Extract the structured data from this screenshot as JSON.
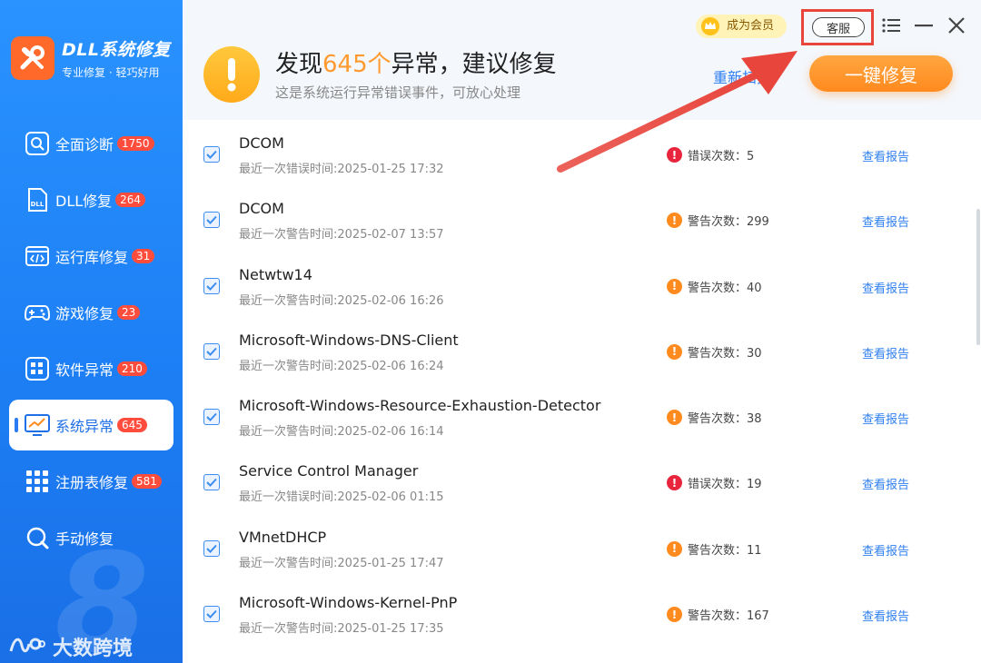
{
  "brand": {
    "title": "DLL系统修复",
    "subtitle": "专业修复 · 轻巧好用"
  },
  "nav": [
    {
      "label": "全面诊断",
      "badge": "1750",
      "icon": "diagnosis-icon",
      "active": false
    },
    {
      "label": "DLL修复",
      "badge": "264",
      "icon": "dll-icon",
      "active": false
    },
    {
      "label": "运行库修复",
      "badge": "31",
      "icon": "runtime-icon",
      "active": false
    },
    {
      "label": "游戏修复",
      "badge": "23",
      "icon": "gamepad-icon",
      "active": false
    },
    {
      "label": "软件异常",
      "badge": "210",
      "icon": "software-icon",
      "active": false
    },
    {
      "label": "系统异常",
      "badge": "645",
      "icon": "system-icon",
      "active": true
    },
    {
      "label": "注册表修复",
      "badge": "581",
      "icon": "registry-icon",
      "active": false
    },
    {
      "label": "手动修复",
      "badge": "",
      "icon": "manual-icon",
      "active": false
    }
  ],
  "watermark": {
    "text": "大数跨境"
  },
  "topbar": {
    "vip_label": "成为会员",
    "service_label": "客服"
  },
  "header": {
    "headline_prefix": "发现",
    "headline_count": "645个",
    "headline_suffix": "异常，建议修复",
    "subline": "这是系统运行异常错误事件，可放心处理",
    "rescan_label": "重新扫描",
    "fix_label": "一键修复"
  },
  "items": [
    {
      "title": "DCOM",
      "time": "最近一次错误时间:2025-01-25 17:32",
      "type": "error",
      "stat": "错误次数：5",
      "report": "查看报告"
    },
    {
      "title": "DCOM",
      "time": "最近一次警告时间:2025-02-07 13:57",
      "type": "warn",
      "stat": "警告次数：299",
      "report": "查看报告"
    },
    {
      "title": "Netwtw14",
      "time": "最近一次警告时间:2025-02-06 16:26",
      "type": "warn",
      "stat": "警告次数：40",
      "report": "查看报告"
    },
    {
      "title": "Microsoft-Windows-DNS-Client",
      "time": "最近一次警告时间:2025-02-06 16:24",
      "type": "warn",
      "stat": "警告次数：30",
      "report": "查看报告"
    },
    {
      "title": "Microsoft-Windows-Resource-Exhaustion-Detector",
      "time": "最近一次警告时间:2025-02-06 16:14",
      "type": "warn",
      "stat": "警告次数：38",
      "report": "查看报告"
    },
    {
      "title": "Service Control Manager",
      "time": "最近一次错误时间:2025-02-06 01:15",
      "type": "error",
      "stat": "错误次数：19",
      "report": "查看报告"
    },
    {
      "title": "VMnetDHCP",
      "time": "最近一次警告时间:2025-01-25 17:47",
      "type": "warn",
      "stat": "警告次数：11",
      "report": "查看报告"
    },
    {
      "title": "Microsoft-Windows-Kernel-PnP",
      "time": "最近一次警告时间:2025-01-25 17:35",
      "type": "warn",
      "stat": "警告次数：167",
      "report": "查看报告"
    }
  ],
  "colors": {
    "sidebar": "#1d7ff5",
    "accent_orange": "#ff8a1e",
    "badge_red": "#ff4d3d",
    "link_blue": "#2f7ff0",
    "error_red": "#e8253c",
    "annotation_red": "#e8453c"
  }
}
